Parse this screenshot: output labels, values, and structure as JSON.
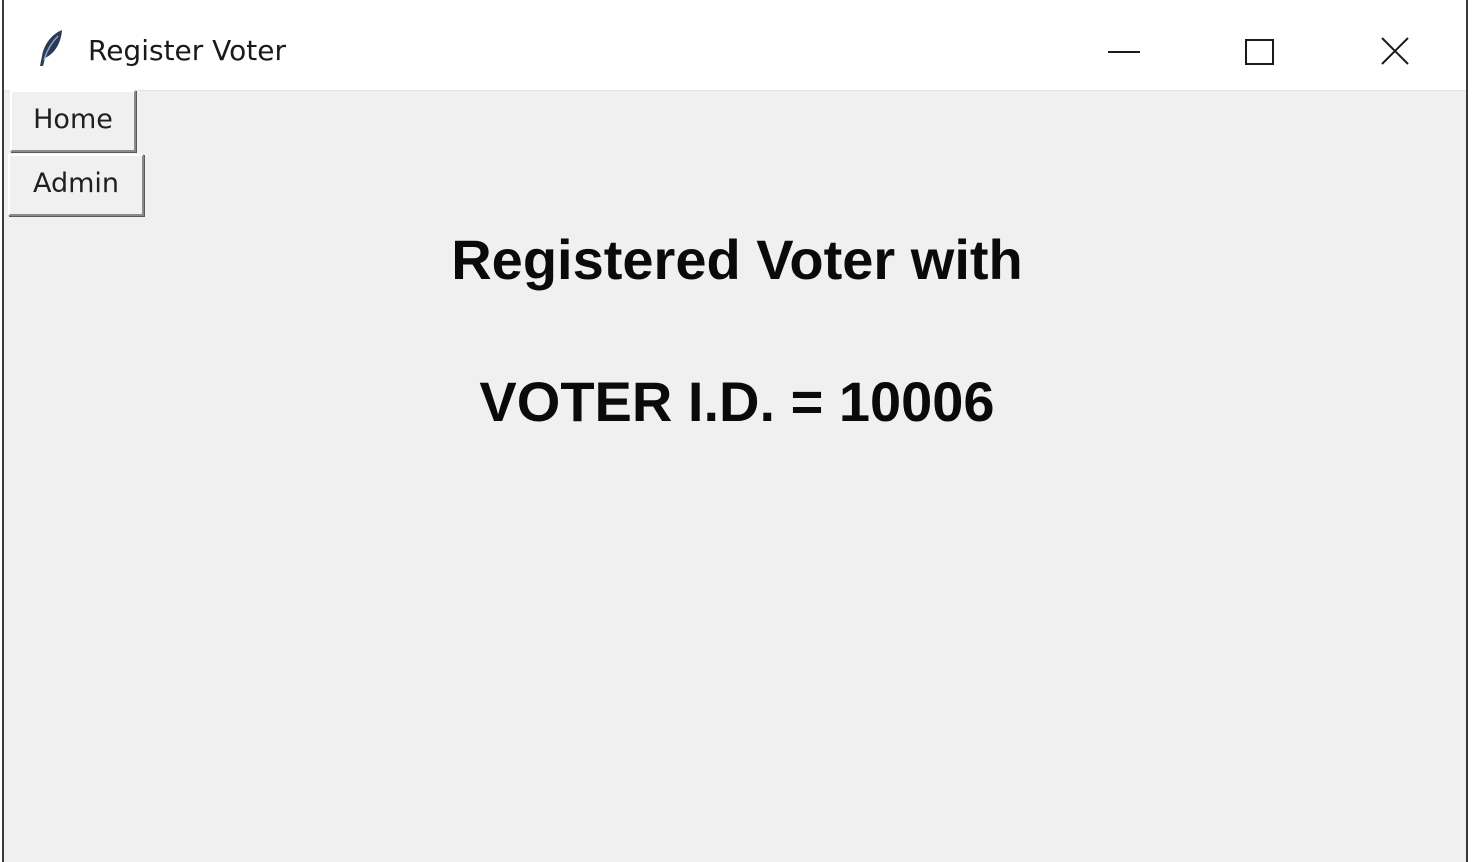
{
  "window": {
    "title": "Register Voter"
  },
  "titlebar": {
    "icons": {
      "app": "feather-icon",
      "minimize": "minimize-icon",
      "maximize": "maximize-icon",
      "close": "close-icon"
    }
  },
  "nav": {
    "home_label": "Home",
    "admin_label": "Admin"
  },
  "main": {
    "message_line1": "Registered Voter with",
    "message_line2": "VOTER I.D. = 10006"
  },
  "colors": {
    "window_bg": "#f0f0f0",
    "titlebar_bg": "#ffffff",
    "text": "#0a0a0a"
  }
}
